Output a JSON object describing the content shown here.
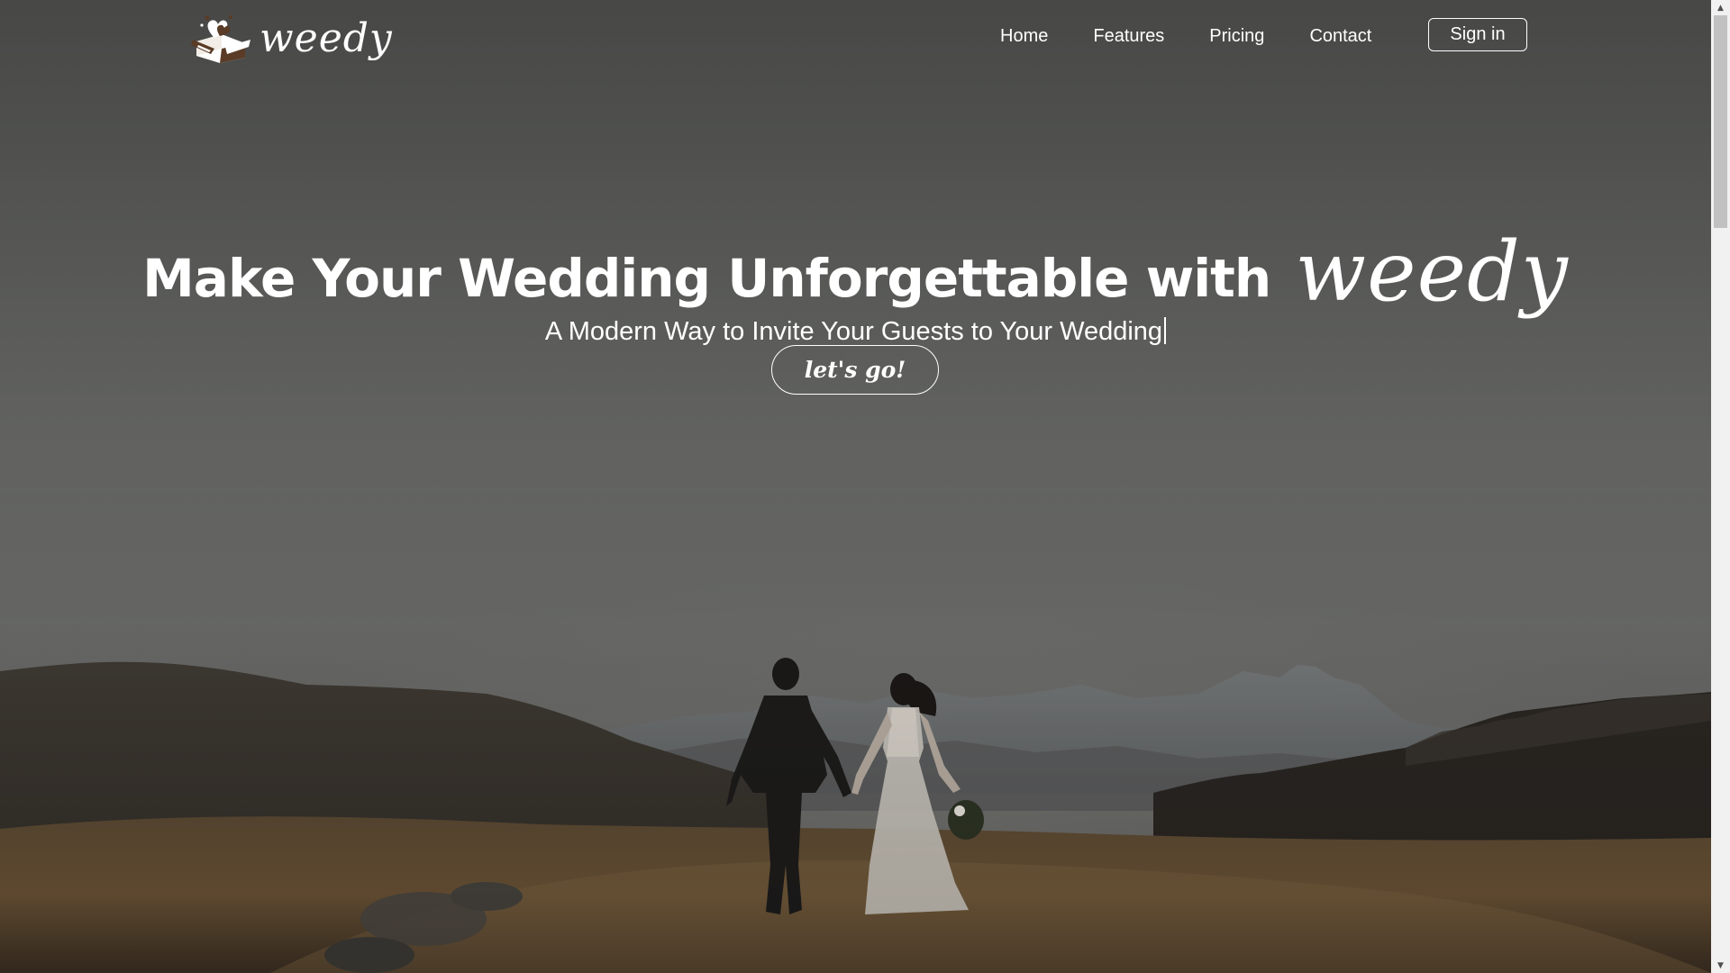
{
  "header": {
    "logo_text": "weedy",
    "nav": [
      {
        "label": "Home"
      },
      {
        "label": "Features"
      },
      {
        "label": "Pricing"
      },
      {
        "label": "Contact"
      }
    ],
    "signin_label": "Sign in"
  },
  "hero": {
    "title": "Make Your Wedding Unforgettable with",
    "title_brand": "weedy",
    "subtitle": "A Modern Way to Invite Your Guests to Your Wedding",
    "cta_label": "let's go!"
  },
  "scrollbar": {
    "up_icon": "▲",
    "down_icon": "▼"
  },
  "colors": {
    "text": "#ffffff",
    "logo_brown": "#5a3b25"
  },
  "icons": {
    "logo": "gift-box-with-hearts-icon"
  }
}
